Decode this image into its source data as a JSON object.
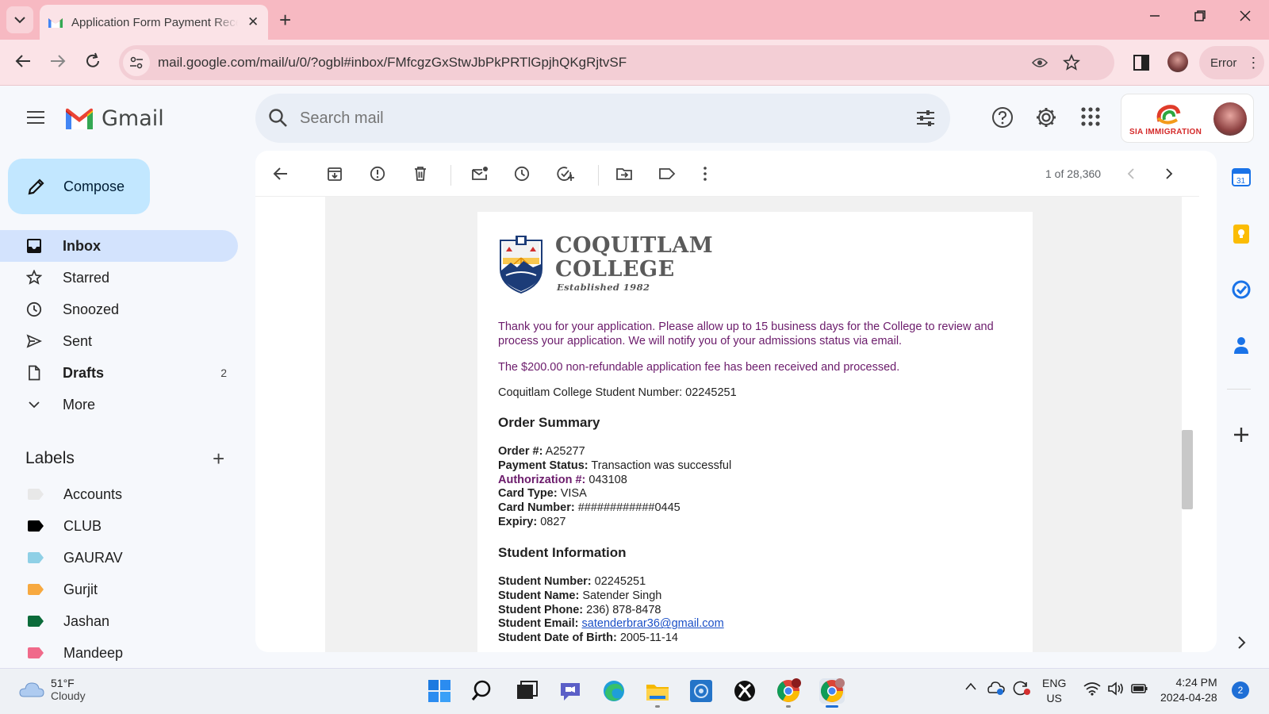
{
  "browser": {
    "tab_title": "Application Form Payment Rece",
    "url": "mail.google.com/mail/u/0/?ogbl#inbox/FMfcgzGxStwJbPkPRTlGpjhQKgRjtvSF",
    "error_label": "Error"
  },
  "gmail": {
    "logo_text": "Gmail",
    "search_placeholder": "Search mail",
    "account_brand": "SIA IMMIGRATION",
    "compose_label": "Compose",
    "nav": [
      {
        "label": "Inbox",
        "count": ""
      },
      {
        "label": "Starred",
        "count": ""
      },
      {
        "label": "Snoozed",
        "count": ""
      },
      {
        "label": "Sent",
        "count": ""
      },
      {
        "label": "Drafts",
        "count": "2"
      },
      {
        "label": "More",
        "count": ""
      }
    ],
    "labels_heading": "Labels",
    "labels": [
      {
        "name": "Accounts",
        "color": "#e8e8e8"
      },
      {
        "name": "CLUB",
        "color": "#000000"
      },
      {
        "name": "GAURAV",
        "color": "#8fd0e6"
      },
      {
        "name": "Gurjit",
        "color": "#f7a940"
      },
      {
        "name": "Jashan",
        "color": "#0b6b3a"
      },
      {
        "name": "Mandeep",
        "color": "#f06a8a"
      }
    ],
    "pager": "1 of 28,360"
  },
  "email": {
    "college_name_line1": "COQUITLAM",
    "college_name_line2": "COLLEGE",
    "college_established": "Established 1982",
    "para1": "Thank you for your application. Please allow up to 15 business days for the College to review and process your application. We will notify you of your admissions status via email.",
    "para2": "The $200.00 non-refundable application fee has been received and processed.",
    "student_number_line": "Coquitlam College Student Number: 02245251",
    "order_heading": "Order Summary",
    "order": {
      "order_k": "Order #:",
      "order_v": "A25277",
      "status_k": "Payment Status:",
      "status_v": "Transaction was successful",
      "auth_k": "Authorization #:",
      "auth_v": "043108",
      "card_type_k": "Card Type:",
      "card_type_v": "VISA",
      "card_num_k": "Card Number:",
      "card_num_v": "############0445",
      "expiry_k": "Expiry:",
      "expiry_v": "0827"
    },
    "student_heading": "Student Information",
    "student": {
      "num_k": "Student Number:",
      "num_v": "02245251",
      "name_k": "Student Name:",
      "name_v": "Satender Singh",
      "phone_k": "Student Phone:",
      "phone_v": "236) 878-8478",
      "email_k": "Student Email:",
      "email_v": "satenderbrar36@gmail.com",
      "dob_k": "Student Date of Birth:",
      "dob_v": "2005-11-14"
    }
  },
  "taskbar": {
    "temp": "51°F",
    "condition": "Cloudy",
    "lang1": "ENG",
    "lang2": "US",
    "time": "4:24 PM",
    "date": "2024-04-28",
    "notifications": "2"
  }
}
